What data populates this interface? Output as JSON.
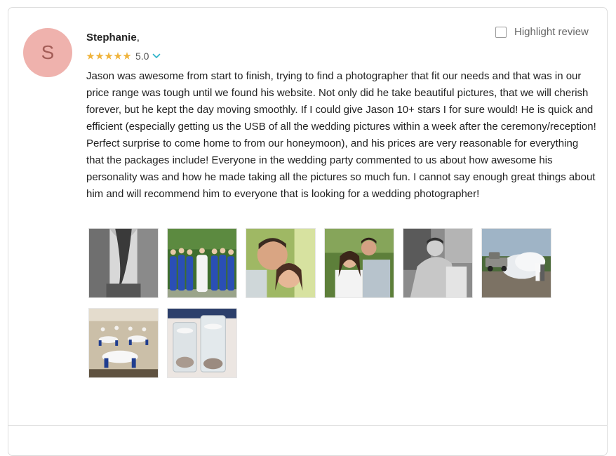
{
  "reviewer": {
    "initial": "S",
    "name": "Stephanie",
    "name_suffix": ","
  },
  "rating": {
    "stars": 5,
    "score": "5.0"
  },
  "highlight": {
    "label": "Highlight review",
    "checked": false
  },
  "review_text": "Jason was awesome from start to finish, trying to find a photographer that fit our needs and that was in our price range was tough until we found his website. Not only did he take beautiful pictures, that we will cherish forever, but he kept the day moving smoothly. If I could give Jason 10+ stars I for sure would! He is quick and efficient (especially getting us the USB of all the wedding pictures within a week after the ceremony/reception! Perfect surprise to come home to from our honeymoon), and his prices are very reasonable for everything that the packages include! Everyone in the wedding party commented to us about how awesome his personality was and how he made taking all the pictures so much fun. I cannot say enough great things about him and will recommend him to everyone that is looking for a wedding photographer!",
  "colors": {
    "avatar_bg": "#efb2ad",
    "avatar_text": "#a35d57",
    "star": "#f0b43c",
    "chevron": "#2bb2c9"
  },
  "photos": [
    {
      "subject": "couple-back-bw-photo"
    },
    {
      "subject": "bridesmaids-blue-dresses-photo"
    },
    {
      "subject": "couple-smiling-closeup-photo"
    },
    {
      "subject": "couple-portrait-trees-photo"
    },
    {
      "subject": "couple-hug-bw-photo"
    },
    {
      "subject": "truck-burnout-couple-photo"
    },
    {
      "subject": "reception-hall-tables-photo"
    },
    {
      "subject": "candle-centerpiece-photo"
    }
  ]
}
